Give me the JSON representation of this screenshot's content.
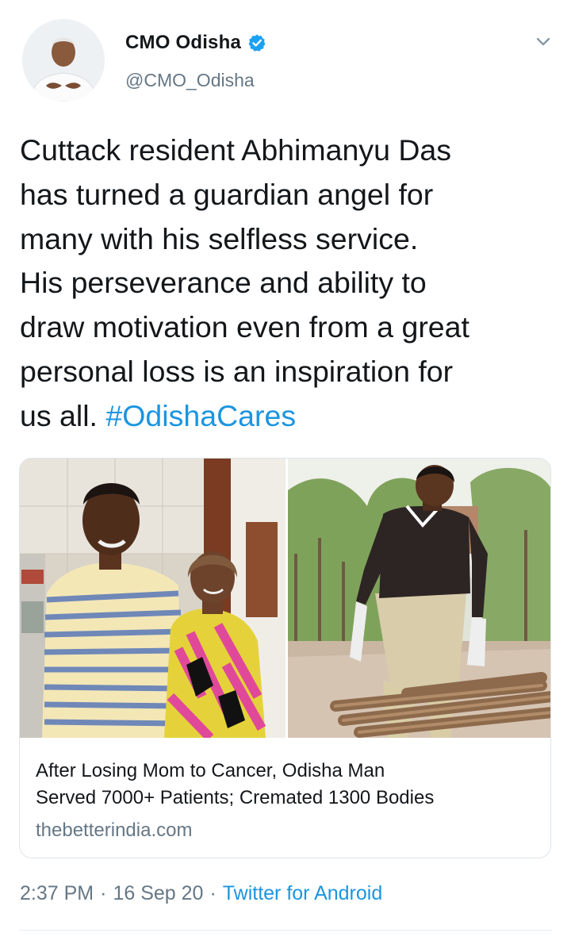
{
  "author": {
    "display_name": "CMO Odisha",
    "handle": "@CMO_Odisha",
    "verified": true,
    "avatar_icon": "profile-avatar"
  },
  "tweet": {
    "text": "Cuttack resident Abhimanyu Das\nhas turned a guardian angel for\nmany with his selfless service.\nHis perseverance and ability to\ndraw motivation even from a great\npersonal loss is an inspiration for\nus all. ",
    "hashtag": "#OdishaCares"
  },
  "card": {
    "title": "After Losing Mom to Cancer, Odisha Man\nServed 7000+ Patients; Cremated 1300 Bodies",
    "domain": "thebetterindia.com"
  },
  "meta": {
    "time": "2:37 PM",
    "separator": "·",
    "date": "16 Sep 20",
    "source": "Twitter for Android"
  },
  "colors": {
    "link": "#1b95e0",
    "secondary_text": "#657786",
    "verified_badge": "#1da1f2",
    "card_border": "#dfe4e8"
  },
  "icons": {
    "verified": "verified-badge-icon",
    "menu": "chevron-down-icon"
  }
}
